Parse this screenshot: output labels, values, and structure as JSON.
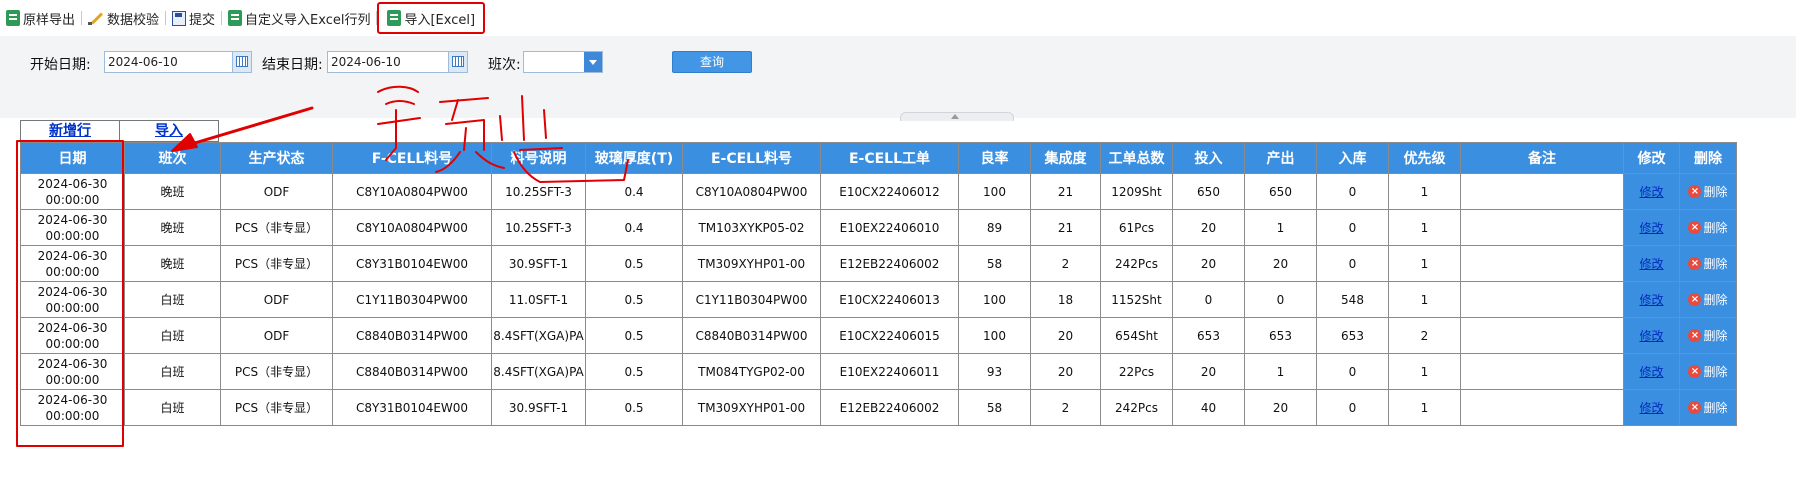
{
  "toolbar": {
    "items": [
      {
        "label": "原样导出",
        "icon": "excel-export-icon"
      },
      {
        "label": "数据校验",
        "icon": "pencil-icon"
      },
      {
        "label": "提交",
        "icon": "save-icon"
      },
      {
        "label": "自定义导入Excel行列",
        "icon": "excel-import-icon"
      },
      {
        "label": "导入[Excel]",
        "icon": "excel-import-icon"
      }
    ]
  },
  "filter": {
    "start_label": "开始日期:",
    "start_value": "2024-06-10",
    "end_label": "结束日期:",
    "end_value": "2024-06-10",
    "shift_label": "班次:",
    "shift_value": "",
    "query_label": "查询"
  },
  "tabs": {
    "add_row": "新增行",
    "import": "导入"
  },
  "table": {
    "columns": [
      "日期",
      "班次",
      "生产状态",
      "F-CELL料号",
      "料号说明",
      "玻璃厚度(T)",
      "E-CELL料号",
      "E-CELL工单",
      "良率",
      "集成度",
      "工单总数",
      "投入",
      "产出",
      "入库",
      "优先级",
      "备注",
      "修改",
      "删除"
    ],
    "edit_label": "修改",
    "delete_label": "删除",
    "rows": [
      [
        "2024-06-30 00:00:00",
        "晚班",
        "ODF",
        "C8Y10A0804PW00",
        "10.25SFT-3",
        "0.4",
        "C8Y10A0804PW00",
        "E10CX22406012",
        "100",
        "21",
        "1209Sht",
        "650",
        "650",
        "0",
        "1",
        ""
      ],
      [
        "2024-06-30 00:00:00",
        "晚班",
        "PCS（非专显）",
        "C8Y10A0804PW00",
        "10.25SFT-3",
        "0.4",
        "TM103XYKP05-02",
        "E10EX22406010",
        "89",
        "21",
        "61Pcs",
        "20",
        "1",
        "0",
        "1",
        ""
      ],
      [
        "2024-06-30 00:00:00",
        "晚班",
        "PCS（非专显）",
        "C8Y31B0104EW00",
        "30.9SFT-1",
        "0.5",
        "TM309XYHP01-00",
        "E12EB22406002",
        "58",
        "2",
        "242Pcs",
        "20",
        "20",
        "0",
        "1",
        ""
      ],
      [
        "2024-06-30 00:00:00",
        "白班",
        "ODF",
        "C1Y11B0304PW00",
        "11.0SFT-1",
        "0.5",
        "C1Y11B0304PW00",
        "E10CX22406013",
        "100",
        "18",
        "1152Sht",
        "0",
        "0",
        "548",
        "1",
        ""
      ],
      [
        "2024-06-30 00:00:00",
        "白班",
        "ODF",
        "C8840B0314PW00",
        "8.4SFT(XGA)PA",
        "0.5",
        "C8840B0314PW00",
        "E10CX22406015",
        "100",
        "20",
        "654Sht",
        "653",
        "653",
        "653",
        "2",
        ""
      ],
      [
        "2024-06-30 00:00:00",
        "白班",
        "PCS（非专显）",
        "C8840B0314PW00",
        "8.4SFT(XGA)PA",
        "0.5",
        "TM084TYGP02-00",
        "E10EX22406011",
        "93",
        "20",
        "22Pcs",
        "20",
        "1",
        "0",
        "1",
        ""
      ],
      [
        "2024-06-30 00:00:00",
        "白班",
        "PCS（非专显）",
        "C8Y31B0104EW00",
        "30.9SFT-1",
        "0.5",
        "TM309XYHP01-00",
        "E12EB22406002",
        "58",
        "2",
        "242Pcs",
        "40",
        "20",
        "0",
        "1",
        ""
      ]
    ]
  },
  "annotation": {
    "stroke_color": "#e00000",
    "handwriting": "预览"
  },
  "colors": {
    "header_blue": "#3b8fe0",
    "highlight_red": "#e00000",
    "link_blue": "#002dbb"
  }
}
